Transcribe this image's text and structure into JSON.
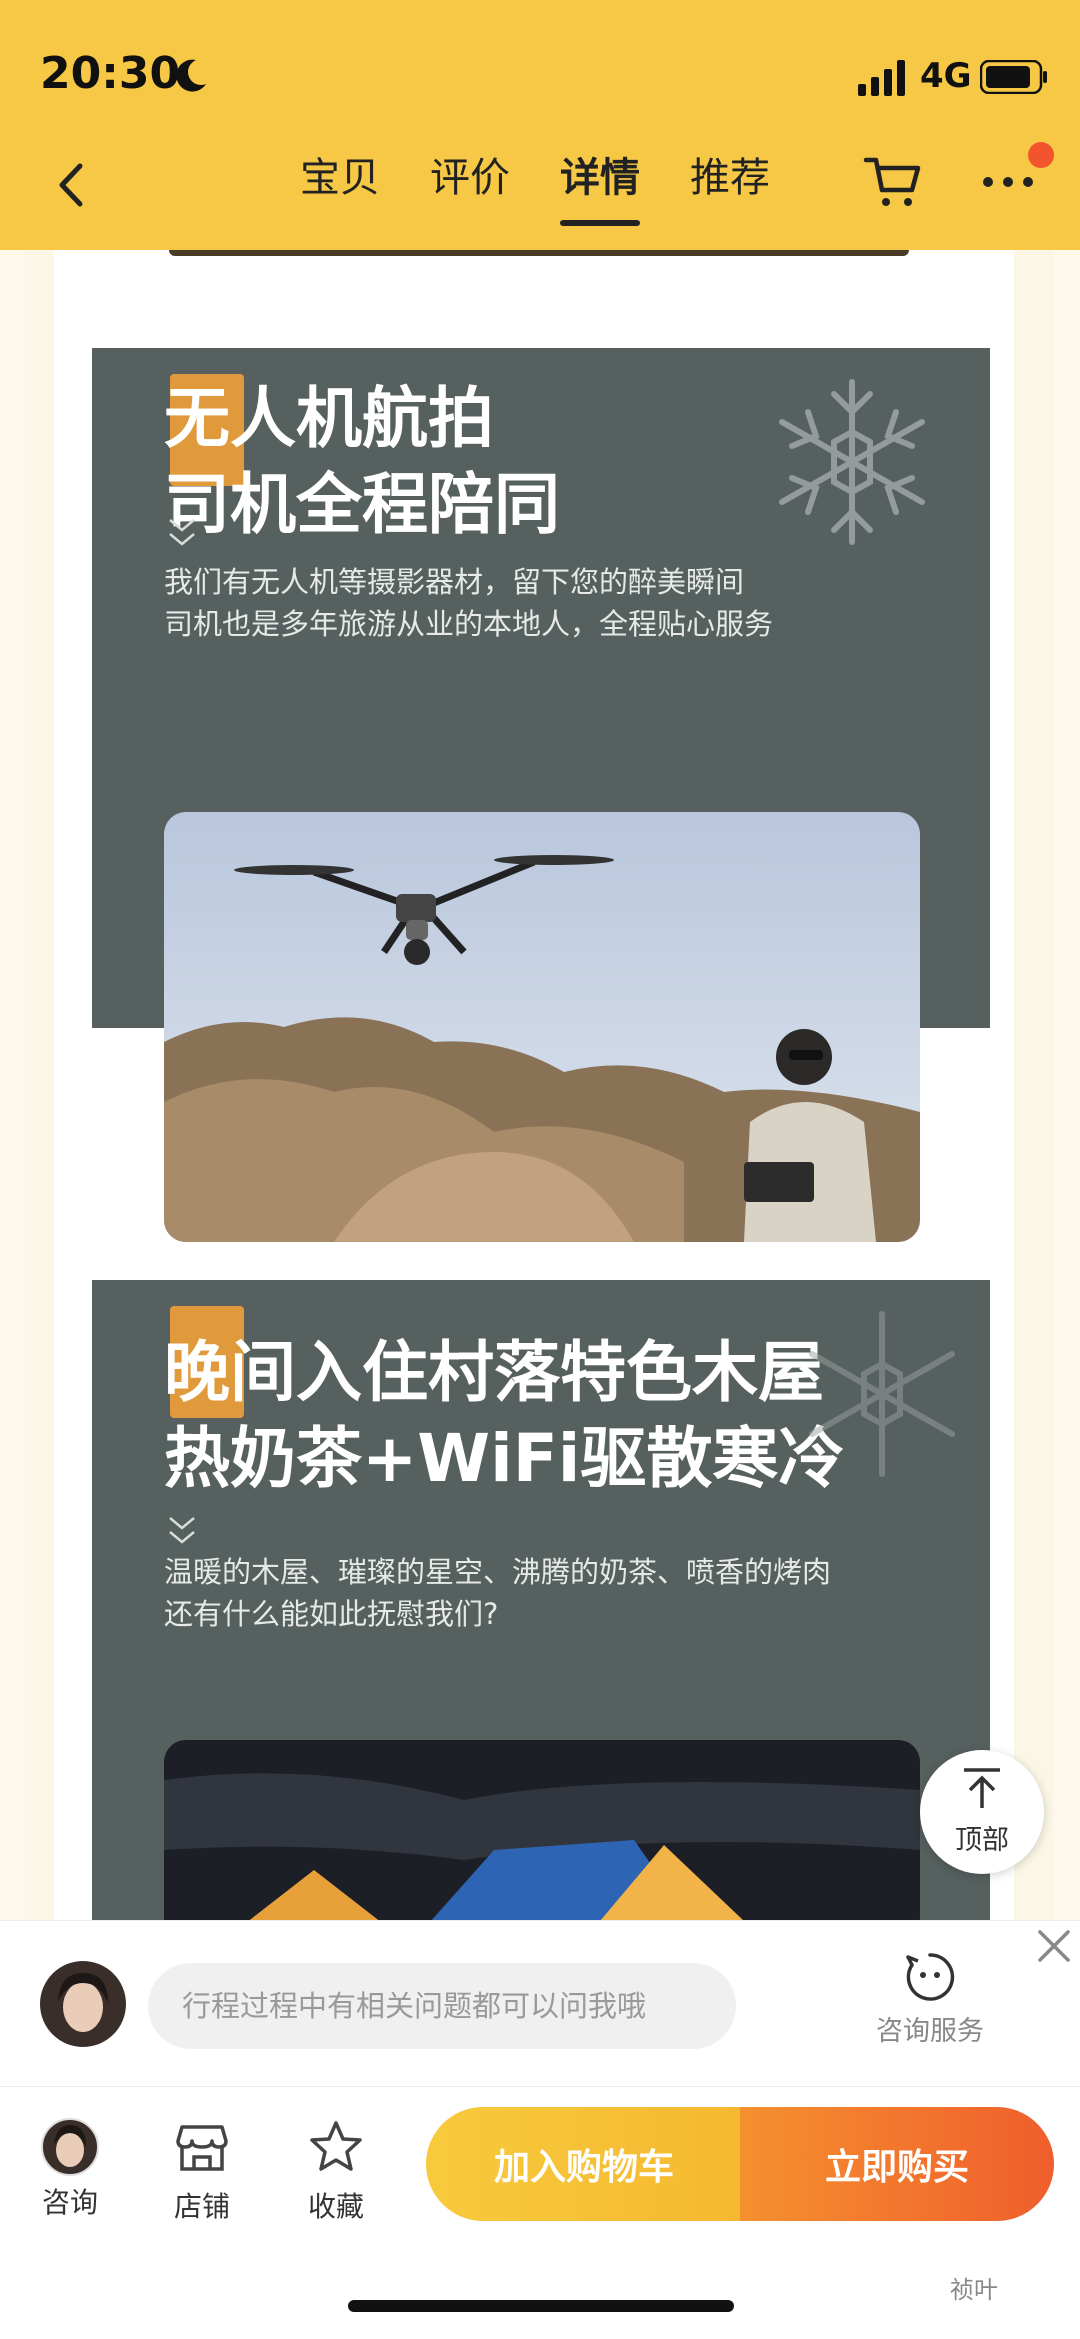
{
  "status_bar": {
    "time": "20:30",
    "network": "4G"
  },
  "nav": {
    "tabs": [
      {
        "label": "宝贝",
        "active": false
      },
      {
        "label": "评价",
        "active": false
      },
      {
        "label": "详情",
        "active": true
      },
      {
        "label": "推荐",
        "active": false
      }
    ]
  },
  "sections": [
    {
      "title_line1": "无人机航拍",
      "title_line2": "司机全程陪同",
      "desc_line1": "我们有无人机等摄影器材，留下您的醉美瞬间",
      "desc_line2": "司机也是多年旅游从业的本地人，全程贴心服务"
    },
    {
      "title_line1": "晚间入住村落特色木屋",
      "title_line2": "热奶茶+WiFi驱散寒冷",
      "desc_line1": "温暖的木屋、璀璨的星空、沸腾的奶茶、喷香的烤肉",
      "desc_line2": "还有什么能如此抚慰我们?"
    }
  ],
  "to_top": {
    "label": "顶部"
  },
  "chat": {
    "placeholder": "行程过程中有相关问题都可以问我哦",
    "service_label": "咨询服务"
  },
  "bottom_nav": {
    "consult": "咨询",
    "shop": "店铺",
    "favorite": "收藏",
    "add_to_cart": "加入购物车",
    "buy_now": "立即购买"
  },
  "watermark": "祯叶",
  "colors": {
    "header": "#f6c845",
    "section_bg": "#56605f",
    "accent": "#e19a3b",
    "buy": "#ef5e2c"
  }
}
